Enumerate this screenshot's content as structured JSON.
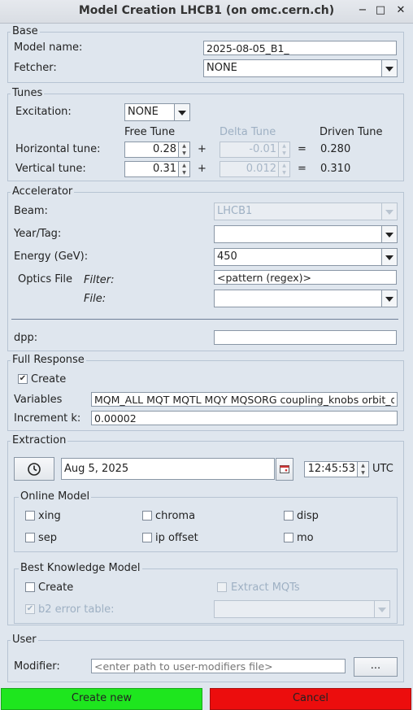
{
  "window": {
    "title": "Model Creation LHCB1 (on omc.cern.ch)",
    "minimize_glyph": "−",
    "maximize_glyph": "□",
    "close_glyph": "✕"
  },
  "base": {
    "legend": "Base",
    "model_name_label": "Model name:",
    "model_name_value": "2025-08-05_B1_",
    "fetcher_label": "Fetcher:",
    "fetcher_value": "NONE"
  },
  "tunes": {
    "legend": "Tunes",
    "excitation_label": "Excitation:",
    "excitation_value": "NONE",
    "free_tune_header": "Free Tune",
    "delta_tune_header": "Delta Tune",
    "driven_tune_header": "Driven Tune",
    "horizontal_label": "Horizontal tune:",
    "horizontal_free": "0.28",
    "horizontal_delta": "-0.01",
    "horizontal_driven": "0.280",
    "vertical_label": "Vertical tune:",
    "vertical_free": "0.31",
    "vertical_delta": "0.012",
    "vertical_driven": "0.310",
    "plus": "+",
    "equals": "="
  },
  "accelerator": {
    "legend": "Accelerator",
    "beam_label": "Beam:",
    "beam_value": "LHCB1",
    "year_tag_label": "Year/Tag:",
    "year_tag_value": "",
    "energy_label": "Energy (GeV):",
    "energy_value": "450",
    "optics_file_label": "Optics File",
    "filter_label": "Filter:",
    "filter_value": "<pattern (regex)>",
    "file_label": "File:",
    "file_value": "",
    "dpp_label": "dpp:",
    "dpp_value": ""
  },
  "full_response": {
    "legend": "Full Response",
    "create_label": "Create",
    "create_checked": true,
    "variables_label": "Variables",
    "variables_value": "MQM_ALL MQT MQTL MQY MQSORG coupling_knobs orbit_dpp",
    "increment_label": "Increment k:",
    "increment_value": "0.00002"
  },
  "extraction": {
    "legend": "Extraction",
    "date_value": "Aug 5, 2025",
    "time_value": "12:45:53",
    "timezone": "UTC",
    "online_model": {
      "legend": "Online Model",
      "options": [
        "xing",
        "chroma",
        "disp",
        "sep",
        "ip offset",
        "mo"
      ]
    },
    "best_knowledge": {
      "legend": "Best Knowledge Model",
      "create_label": "Create",
      "extract_mqts_label": "Extract MQTs",
      "b2_error_table_label": "b2 error table:",
      "b2_error_table_value": ""
    }
  },
  "user": {
    "legend": "User",
    "modifier_label": "Modifier:",
    "modifier_placeholder": "<enter path to user-modifiers file>",
    "browse_label": "..."
  },
  "actions": {
    "create_new_label": "Create new",
    "cancel_label": "Cancel",
    "create_new_color": "#1ee61e",
    "cancel_color": "#ec0d0d"
  }
}
